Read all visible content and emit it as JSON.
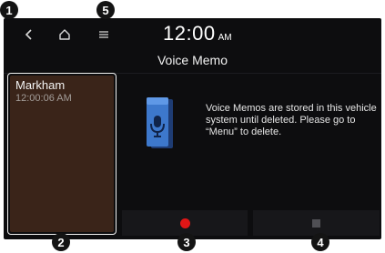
{
  "topbar": {
    "back_icon": "chevron-left-icon",
    "home_icon": "home-icon",
    "menu_icon": "hamburger-menu-icon",
    "clock_time": "12:00",
    "clock_ampm": "AM"
  },
  "title": "Voice Memo",
  "memos": [
    {
      "name": "Markham",
      "time": "12:00:06 AM"
    }
  ],
  "info": {
    "icon": "voice-memo-book-icon",
    "text": "Voice Memos are stored in this vehicle system until deleted. Please go to “Menu” to delete."
  },
  "controls": {
    "record_icon": "record-icon",
    "stop_icon": "stop-icon",
    "record_color": "#e01616"
  },
  "callouts": [
    "1",
    "2",
    "3",
    "4",
    "5"
  ]
}
